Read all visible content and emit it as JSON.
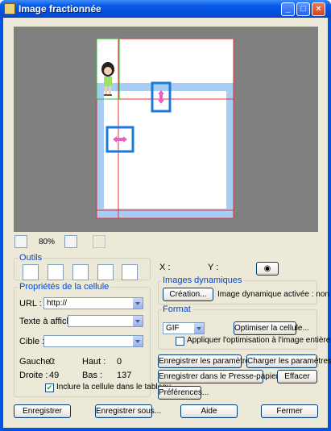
{
  "window": {
    "title": "Image fractionnée",
    "min": "_",
    "max": "□",
    "close": "×"
  },
  "view": {
    "zoom": "80%"
  },
  "tools": {
    "legend": "Outils"
  },
  "coords": {
    "x_label": "X :",
    "y_label": "Y :"
  },
  "cell": {
    "legend": "Propriétés de la cellule",
    "url_label": "URL :",
    "url_value": "http://",
    "text_label": "Texte à afficher :",
    "text_value": "",
    "target_label": "Cible :",
    "target_value": "",
    "left_label": "Gauche :",
    "left_value": "0",
    "top_label": "Haut :",
    "top_value": "0",
    "right_label": "Droite :",
    "right_value": "49",
    "bottom_label": "Bas :",
    "bottom_value": "137",
    "include_label": "Inclure la cellule dans le tableau",
    "include_checked": true
  },
  "dynamic": {
    "legend": "Images dynamiques",
    "create_btn": "Création...",
    "status": "Image dynamique activée : non"
  },
  "format": {
    "legend": "Format",
    "value": "GIF",
    "optimize_btn": "Optimiser la cellule...",
    "apply_label": "Appliquer l'optimisation à l'image entière",
    "apply_checked": false
  },
  "actions": {
    "save_params": "Enregistrer les paramètres...",
    "load_params": "Charger les paramètres...",
    "save_clipboard": "Enregistrer dans le Presse-papiers...",
    "clear": "Effacer",
    "prefs": "Préférences..."
  },
  "footer": {
    "save": "Enregistrer",
    "save_as": "Enregistrer sous...",
    "help": "Aide",
    "close": "Fermer"
  }
}
